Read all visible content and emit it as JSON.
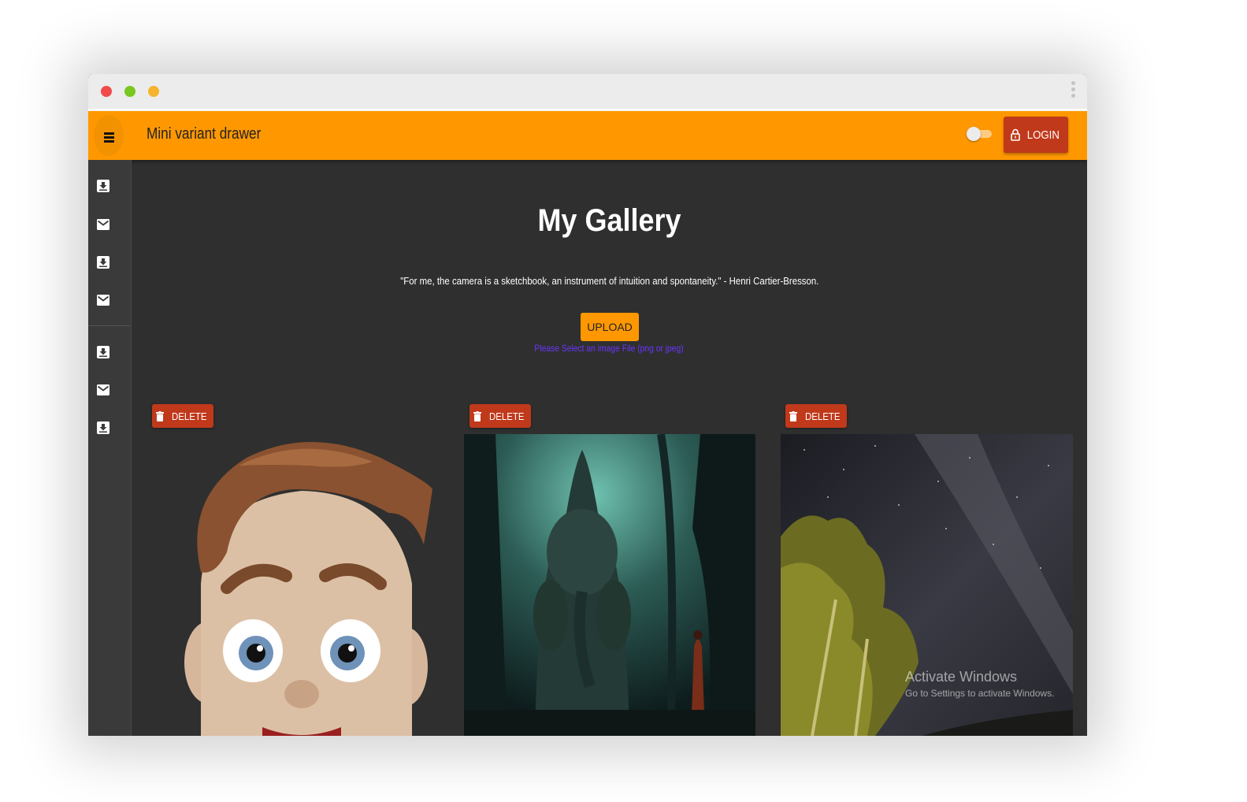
{
  "window": {
    "controls": [
      "close-dot",
      "maximize-dot",
      "minimize-dot"
    ],
    "colors": {
      "close": "#f14b4b",
      "maximize": "#7ac81f",
      "minimize": "#f5b32f"
    }
  },
  "appbar": {
    "title": "Mini variant drawer",
    "login_label": "LOGIN",
    "theme_toggle_on": false,
    "color": "#ff9800"
  },
  "sidebar": {
    "group1": [
      "move-to-inbox-icon",
      "mail-icon",
      "move-to-inbox-icon",
      "mail-icon"
    ],
    "group2": [
      "move-to-inbox-icon",
      "mail-icon",
      "move-to-inbox-icon"
    ]
  },
  "main": {
    "title": "My Gallery",
    "quote": "\"For me, the camera is a sketchbook, an instrument of intuition and spontaneity.\" - Henri Cartier-Bresson.",
    "upload_label": "UPLOAD",
    "upload_hint": "Please Select an image File (png or jpeg)"
  },
  "gallery": [
    {
      "delete_label": "DELETE",
      "image": "cartoon-avatar"
    },
    {
      "delete_label": "DELETE",
      "image": "forest-ganesha-statue"
    },
    {
      "delete_label": "DELETE",
      "image": "milky-way-trees"
    }
  ],
  "watermark": {
    "line1": "Activate Windows",
    "line2": "Go to Settings to activate Windows."
  }
}
